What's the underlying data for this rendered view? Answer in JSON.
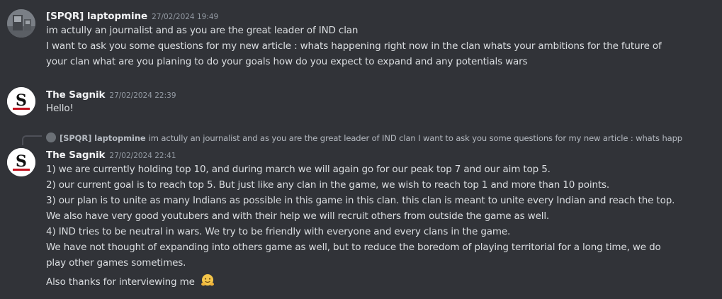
{
  "messages": [
    {
      "author": "[SPQR] laptopmine",
      "timestamp": "27/02/2024 19:49",
      "lines": [
        "im actully an journalist and as you are the great leader of IND clan",
        "I want to ask you some questions for my new article : whats happening right now in the clan whats your ambitions for the future of",
        "your clan what are you planing to do your goals how do you expect to expand and any potentials wars"
      ]
    },
    {
      "author": "The Sagnik",
      "timestamp": "27/02/2024 22:39",
      "lines": [
        "Hello!"
      ]
    },
    {
      "author": "The Sagnik",
      "timestamp": "27/02/2024 22:41",
      "reply": {
        "author": "[SPQR] laptopmine",
        "text": "im actully an journalist and as you are the great leader of IND clan I want to ask you some questions for my new article : whats happ"
      },
      "lines": [
        "1) we are currently holding top 10, and during march we will again go for our peak top 7 and our aim top 5.",
        "2) our current goal is to reach top 5. But just like any clan in the game, we wish to reach top 1 and more than 10 points.",
        "3) our plan is to unite as many Indians as possible in this game in this clan. this clan is meant to unite every Indian and reach the top.",
        "We also have very good youtubers and with their help we will recruit others from outside the game as well.",
        "4) IND tries to be neutral in wars. We try to be friendly with everyone and every clans in the game.",
        "We have not thought of expanding into others game as well, but to reduce the boredom of playing territorial for a long time, we do",
        "play other games sometimes.",
        "Also thanks for interviewing me"
      ],
      "trailing_emoji": "hugging-face-emoji"
    }
  ],
  "avatar_logo_letter": "S",
  "colors": {
    "background": "#313338",
    "author": "#f2f3f5",
    "text": "#dbdee1",
    "timestamp": "#949ba4",
    "reply_line": "#4e5058"
  }
}
